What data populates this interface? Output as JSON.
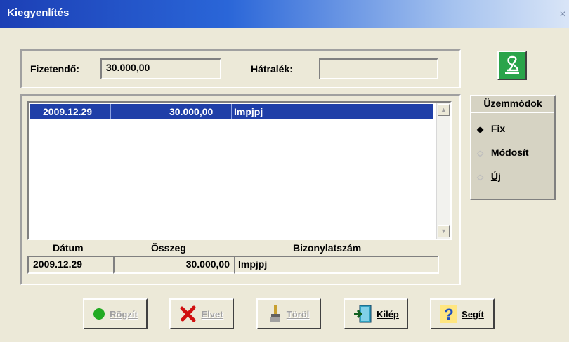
{
  "window": {
    "title": "Kiegyenlítés",
    "close_glyph": "×"
  },
  "summary": {
    "fizetendo_label": "Fizetendő:",
    "fizetendo_value": "30.000,00",
    "hatralek_label": "Hátralék:",
    "hatralek_value": ""
  },
  "list": {
    "selected_row": {
      "datum": "2009.12.29",
      "osszeg": "30.000,00",
      "bizonylatszam": "Impjpj"
    },
    "scroll_up": "▲",
    "scroll_down": "▼"
  },
  "detail": {
    "headers": {
      "datum": "Dátum",
      "osszeg": "Összeg",
      "bizonylatszam": "Bizonylatszám"
    },
    "datum": "2009.12.29",
    "osszeg": "30.000,00",
    "bizonylatszam": "Impjpj"
  },
  "modes": {
    "title": "Üzemmódok",
    "items": [
      {
        "label": "Fix",
        "selected": true
      },
      {
        "label": "Módosít",
        "selected": false
      },
      {
        "label": "Új",
        "selected": false
      }
    ]
  },
  "top_icon": "cobra-icon",
  "buttons": {
    "rogzit": "Rögzít",
    "elvet": "Elvet",
    "torol": "Töröl",
    "kilep": "Kilép",
    "segit": "Segít"
  },
  "colors": {
    "titlebar": "#1c3fb5",
    "selection": "#1f3fa8",
    "accent_green": "#2aa44a"
  }
}
